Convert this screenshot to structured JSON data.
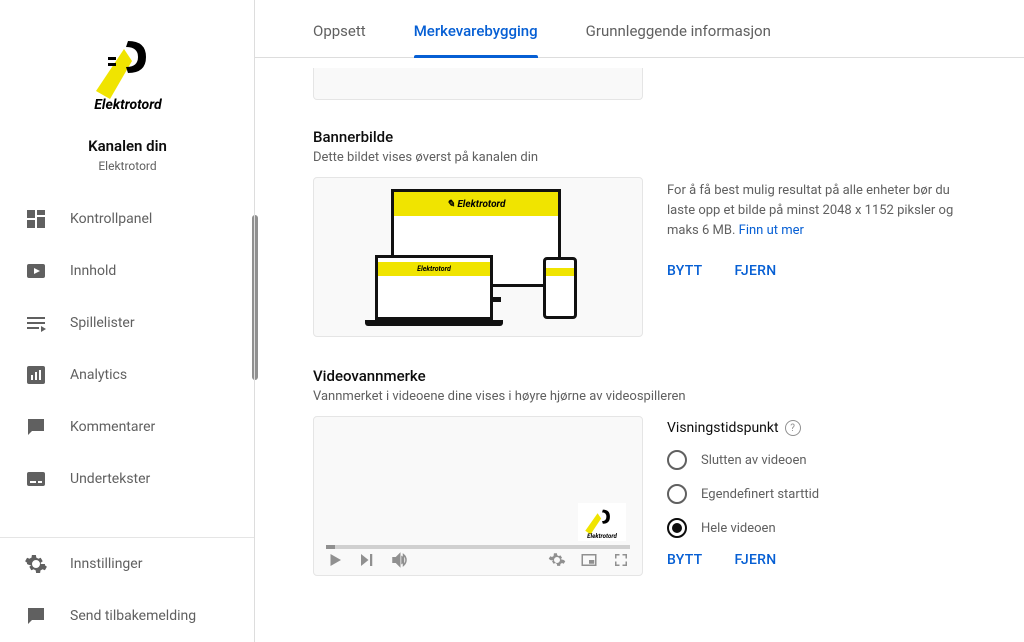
{
  "channel": {
    "section_title": "Kanalen din",
    "name": "Elektrotord",
    "logo_text": "Elektrotord"
  },
  "nav": {
    "dashboard": "Kontrollpanel",
    "content": "Innhold",
    "playlists": "Spillelister",
    "analytics": "Analytics",
    "comments": "Kommentarer",
    "subtitles": "Undertekster",
    "settings": "Innstillinger",
    "feedback": "Send tilbakemelding"
  },
  "tabs": {
    "layout": "Oppsett",
    "branding": "Merkevarebygging",
    "basic": "Grunnleggende informasjon"
  },
  "banner": {
    "title": "Bannerbilde",
    "desc": "Dette bildet vises øverst på kanalen din",
    "info": "For å få best mulig resultat på alle enheter bør du laste opp et bilde på minst 2048 x 1152 piksler og maks 6 MB.",
    "learn_more": "Finn ut mer",
    "change": "BYTT",
    "remove": "FJERN"
  },
  "watermark": {
    "title": "Videovannmerke",
    "desc": "Vannmerket i videoene dine vises i høyre hjørne av videospilleren",
    "timing_title": "Visningstidspunkt",
    "option_end": "Slutten av videoen",
    "option_custom": "Egendefinert starttid",
    "option_whole": "Hele videoen",
    "change": "BYTT",
    "remove": "FJERN",
    "selected": "whole"
  }
}
